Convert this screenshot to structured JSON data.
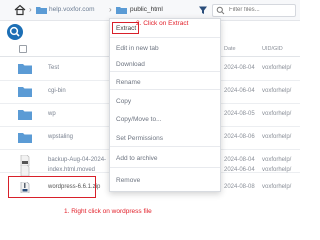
{
  "breadcrumb": {
    "domain": "help.voxfor.com",
    "folder": "public_html"
  },
  "filter": {
    "placeholder": "Filter files..."
  },
  "table": {
    "headers": {
      "date": "Date",
      "uid": "UID/GID"
    },
    "rows": [
      {
        "name": "Test",
        "date": "2024-08-04",
        "uid": "voxforhelp/",
        "type": "folder"
      },
      {
        "name": "cgi-bin",
        "date": "2024-06-04",
        "uid": "voxforhelp/",
        "type": "folder"
      },
      {
        "name": "wp",
        "date": "2024-08-05",
        "uid": "voxforhelp/",
        "type": "folder"
      },
      {
        "name": "wpstaling",
        "date": "2024-08-06",
        "uid": "voxforhelp/",
        "type": "folder"
      },
      {
        "name": "backup-Aug-04-2024-",
        "date": "2024-08-04",
        "uid": "voxforhelp/",
        "type": "file"
      },
      {
        "name": "index.html.moved",
        "date": "2024-06-04",
        "uid": "voxforhelp/",
        "type": "file"
      },
      {
        "name": "wordpress-6.6.1.zip",
        "date": "2024-08-08",
        "uid": "voxforhelp/",
        "type": "zip"
      }
    ]
  },
  "context_menu": {
    "items": [
      "Extract",
      "Edit in new tab",
      "Download",
      "Rename",
      "Copy",
      "Copy/Move to...",
      "Set Permissions",
      "Add to archive",
      "Remove"
    ]
  },
  "annotations": {
    "step2": "2. Click on Extract",
    "step1": "1. Right click on wordpress file"
  },
  "colors": {
    "accent": "#1c6fb5",
    "folder": "#5b9bd5",
    "annotation": "#e2202a"
  }
}
